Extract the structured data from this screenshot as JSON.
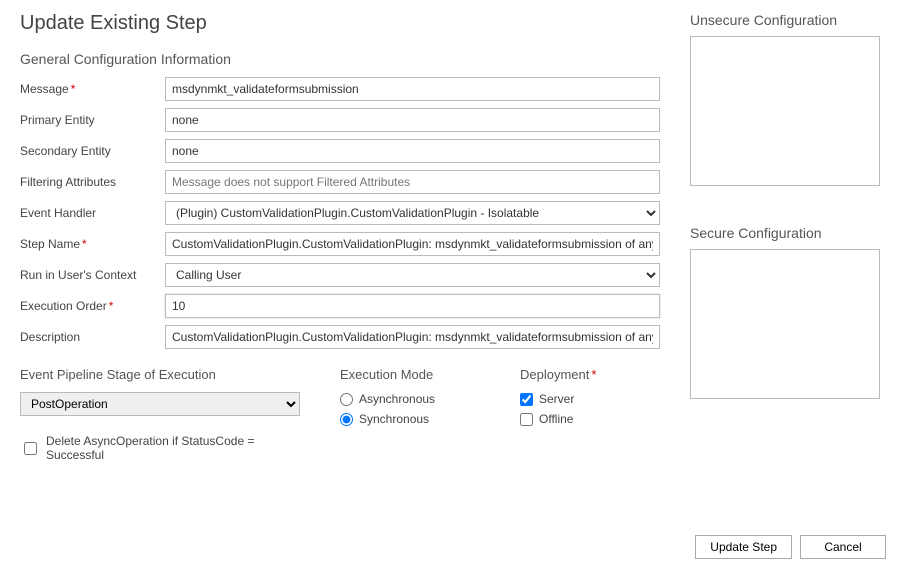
{
  "title": "Update Existing Step",
  "general": {
    "heading": "General Configuration Information",
    "message_label": "Message",
    "message_value": "msdynmkt_validateformsubmission",
    "primary_entity_label": "Primary Entity",
    "primary_entity_value": "none",
    "secondary_entity_label": "Secondary Entity",
    "secondary_entity_value": "none",
    "filtering_attrs_label": "Filtering Attributes",
    "filtering_attrs_placeholder": "Message does not support Filtered Attributes",
    "event_handler_label": "Event Handler",
    "event_handler_value": "(Plugin) CustomValidationPlugin.CustomValidationPlugin - Isolatable",
    "step_name_label": "Step Name",
    "step_name_value": "CustomValidationPlugin.CustomValidationPlugin: msdynmkt_validateformsubmission of any Ent",
    "run_in_context_label": "Run in User's Context",
    "run_in_context_value": "Calling User",
    "execution_order_label": "Execution Order",
    "execution_order_value": "10",
    "description_label": "Description",
    "description_value": "CustomValidationPlugin.CustomValidationPlugin: msdynmkt_validateformsubmission of any Ent"
  },
  "pipeline": {
    "heading": "Event Pipeline Stage of Execution",
    "value": "PostOperation"
  },
  "exec_mode": {
    "heading": "Execution Mode",
    "async_label": "Asynchronous",
    "sync_label": "Synchronous"
  },
  "deployment": {
    "heading": "Deployment",
    "server_label": "Server",
    "offline_label": "Offline"
  },
  "delete_async_label": "Delete AsyncOperation if StatusCode = Successful",
  "unsecure_heading": "Unsecure  Configuration",
  "secure_heading": "Secure  Configuration",
  "footer": {
    "update_label": "Update Step",
    "cancel_label": "Cancel"
  }
}
